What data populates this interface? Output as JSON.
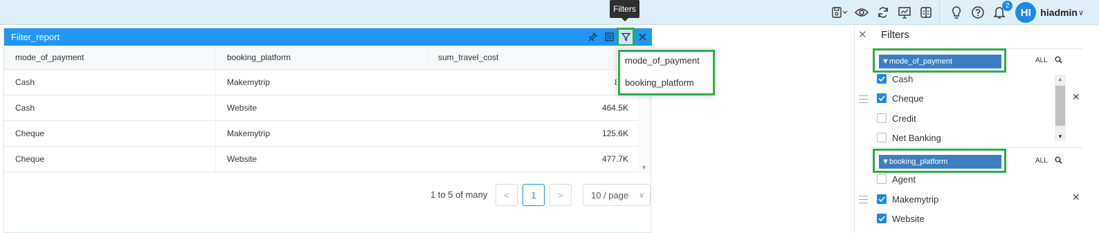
{
  "topbar": {
    "notification_count": "2",
    "avatar_initials": "HI",
    "username": "hiadmin",
    "tooltip": "Filters"
  },
  "widget": {
    "title": "Filter_report",
    "columns": [
      "mode_of_payment",
      "booking_platform",
      "sum_travel_cost"
    ],
    "rows": [
      [
        "Cash",
        "Makemytrip",
        "874"
      ],
      [
        "Cash",
        "Website",
        "464.5K"
      ],
      [
        "Cheque",
        "Makemytrip",
        "125.6K"
      ],
      [
        "Cheque",
        "Website",
        "477.7K"
      ]
    ],
    "pagination": {
      "summary": "1 to 5 of many",
      "prev": "<",
      "current_page": "1",
      "next": ">",
      "page_size": "10 / page"
    }
  },
  "filter_dropdown": {
    "items": [
      "mode_of_payment",
      "booking_platform"
    ]
  },
  "filters_panel": {
    "title": "Filters",
    "sections": [
      {
        "name": "mode_of_payment",
        "all_label": "ALL",
        "options": [
          {
            "label": "Cash",
            "checked": true
          },
          {
            "label": "Cheque",
            "checked": true
          },
          {
            "label": "Credit",
            "checked": false
          },
          {
            "label": "Net Banking",
            "checked": false
          }
        ]
      },
      {
        "name": "booking_platform",
        "all_label": "ALL",
        "options": [
          {
            "label": "Agent",
            "checked": false
          },
          {
            "label": "Makemytrip",
            "checked": true
          },
          {
            "label": "Website",
            "checked": true
          }
        ]
      }
    ]
  },
  "colors": {
    "topbar_bg": "#deeff8",
    "widget_header": "#2196f3",
    "highlight_green": "#2eab4a",
    "chip_blue": "#3a7fc1",
    "check_blue": "#1e88e5"
  }
}
